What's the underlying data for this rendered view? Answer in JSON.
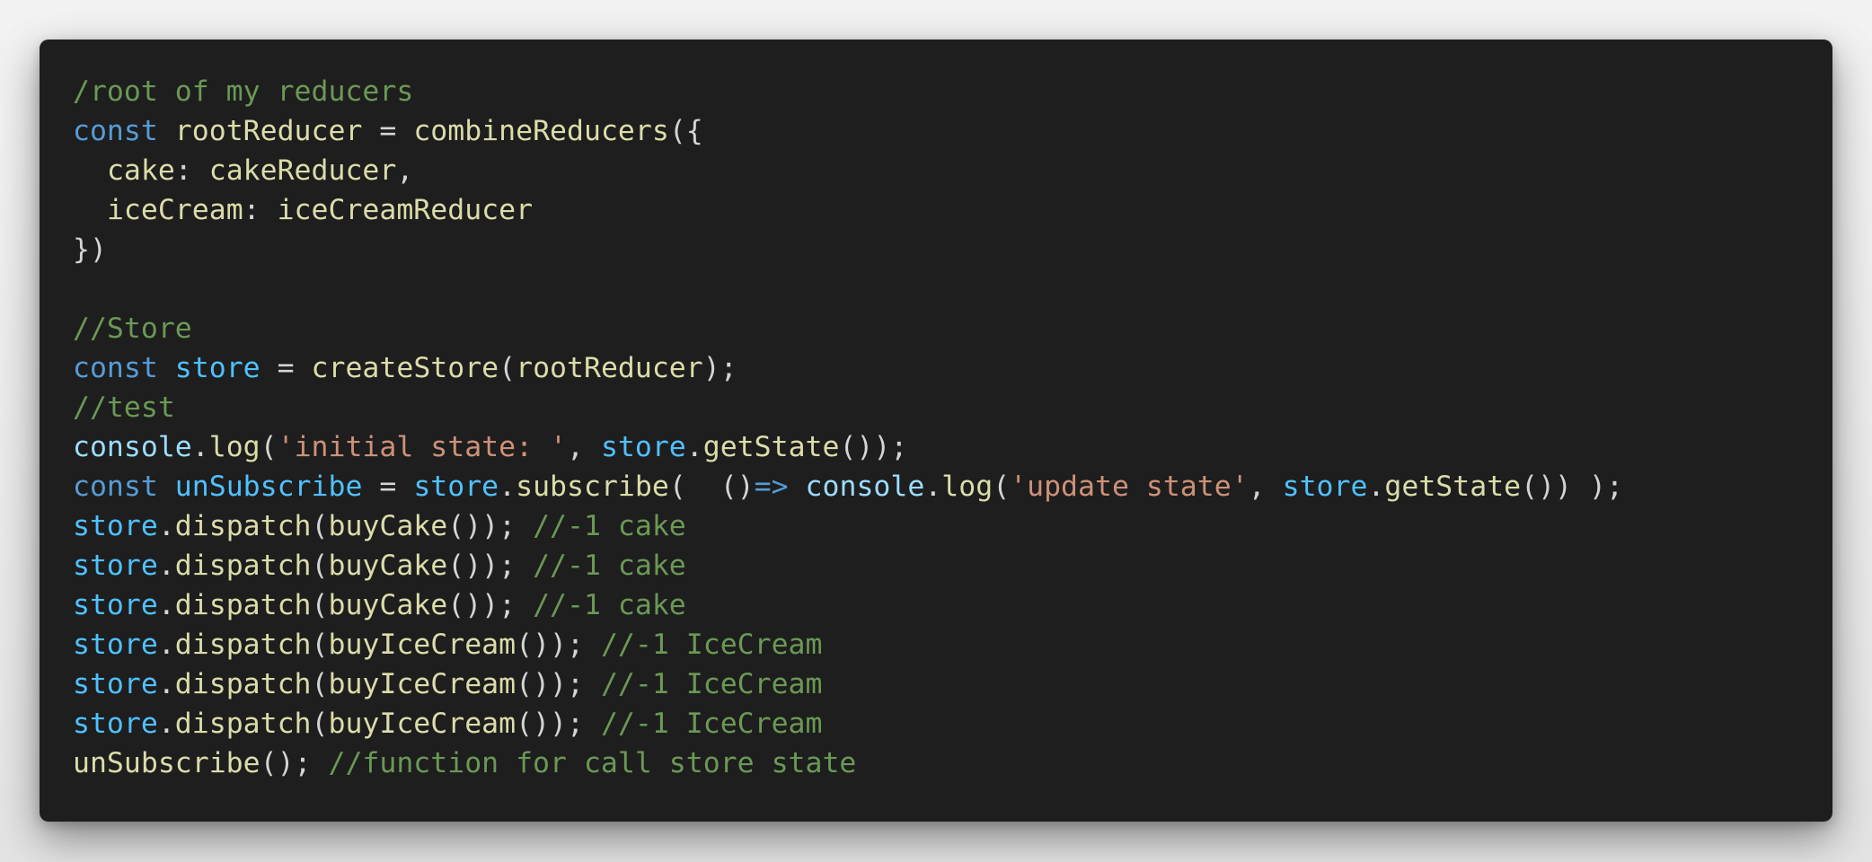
{
  "lines": [
    [
      {
        "t": "/root of my reducers",
        "c": "cmt"
      }
    ],
    [
      {
        "t": "const",
        "c": "kw"
      },
      {
        "t": " ",
        "c": "pun"
      },
      {
        "t": "rootReducer",
        "c": "ident"
      },
      {
        "t": " = ",
        "c": "pun"
      },
      {
        "t": "combineReducers",
        "c": "fn"
      },
      {
        "t": "({",
        "c": "pun"
      }
    ],
    [
      {
        "t": "  ",
        "c": "pun"
      },
      {
        "t": "cake",
        "c": "key"
      },
      {
        "t": ": ",
        "c": "pun"
      },
      {
        "t": "cakeReducer",
        "c": "ident"
      },
      {
        "t": ",",
        "c": "pun"
      }
    ],
    [
      {
        "t": "  ",
        "c": "pun"
      },
      {
        "t": "iceCream",
        "c": "key"
      },
      {
        "t": ": ",
        "c": "pun"
      },
      {
        "t": "iceCreamReducer",
        "c": "ident"
      }
    ],
    [
      {
        "t": "})",
        "c": "pun"
      }
    ],
    [],
    [
      {
        "t": "//Store",
        "c": "cmt"
      }
    ],
    [
      {
        "t": "const",
        "c": "kw"
      },
      {
        "t": " ",
        "c": "pun"
      },
      {
        "t": "store",
        "c": "var"
      },
      {
        "t": " = ",
        "c": "pun"
      },
      {
        "t": "createStore",
        "c": "fn"
      },
      {
        "t": "(",
        "c": "pun"
      },
      {
        "t": "rootReducer",
        "c": "ident"
      },
      {
        "t": ");",
        "c": "pun"
      }
    ],
    [
      {
        "t": "//test",
        "c": "cmt"
      }
    ],
    [
      {
        "t": "console",
        "c": "obj"
      },
      {
        "t": ".",
        "c": "pun"
      },
      {
        "t": "log",
        "c": "fn"
      },
      {
        "t": "(",
        "c": "pun"
      },
      {
        "t": "'initial state: '",
        "c": "str"
      },
      {
        "t": ", ",
        "c": "pun"
      },
      {
        "t": "store",
        "c": "var"
      },
      {
        "t": ".",
        "c": "pun"
      },
      {
        "t": "getState",
        "c": "fn"
      },
      {
        "t": "());",
        "c": "pun"
      }
    ],
    [
      {
        "t": "const",
        "c": "kw"
      },
      {
        "t": " ",
        "c": "pun"
      },
      {
        "t": "unSubscribe",
        "c": "var"
      },
      {
        "t": " = ",
        "c": "pun"
      },
      {
        "t": "store",
        "c": "var"
      },
      {
        "t": ".",
        "c": "pun"
      },
      {
        "t": "subscribe",
        "c": "fn"
      },
      {
        "t": "(  ()",
        "c": "pun"
      },
      {
        "t": "=>",
        "c": "kw"
      },
      {
        "t": " ",
        "c": "pun"
      },
      {
        "t": "console",
        "c": "obj"
      },
      {
        "t": ".",
        "c": "pun"
      },
      {
        "t": "log",
        "c": "fn"
      },
      {
        "t": "(",
        "c": "pun"
      },
      {
        "t": "'update state'",
        "c": "str"
      },
      {
        "t": ", ",
        "c": "pun"
      },
      {
        "t": "store",
        "c": "var"
      },
      {
        "t": ".",
        "c": "pun"
      },
      {
        "t": "getState",
        "c": "fn"
      },
      {
        "t": "()) );",
        "c": "pun"
      }
    ],
    [
      {
        "t": "store",
        "c": "var"
      },
      {
        "t": ".",
        "c": "pun"
      },
      {
        "t": "dispatch",
        "c": "fn"
      },
      {
        "t": "(",
        "c": "pun"
      },
      {
        "t": "buyCake",
        "c": "fn"
      },
      {
        "t": "()); ",
        "c": "pun"
      },
      {
        "t": "//-1 cake",
        "c": "cmt"
      }
    ],
    [
      {
        "t": "store",
        "c": "var"
      },
      {
        "t": ".",
        "c": "pun"
      },
      {
        "t": "dispatch",
        "c": "fn"
      },
      {
        "t": "(",
        "c": "pun"
      },
      {
        "t": "buyCake",
        "c": "fn"
      },
      {
        "t": "()); ",
        "c": "pun"
      },
      {
        "t": "//-1 cake",
        "c": "cmt"
      }
    ],
    [
      {
        "t": "store",
        "c": "var"
      },
      {
        "t": ".",
        "c": "pun"
      },
      {
        "t": "dispatch",
        "c": "fn"
      },
      {
        "t": "(",
        "c": "pun"
      },
      {
        "t": "buyCake",
        "c": "fn"
      },
      {
        "t": "()); ",
        "c": "pun"
      },
      {
        "t": "//-1 cake",
        "c": "cmt"
      }
    ],
    [
      {
        "t": "store",
        "c": "var"
      },
      {
        "t": ".",
        "c": "pun"
      },
      {
        "t": "dispatch",
        "c": "fn"
      },
      {
        "t": "(",
        "c": "pun"
      },
      {
        "t": "buyIceCream",
        "c": "fn"
      },
      {
        "t": "()); ",
        "c": "pun"
      },
      {
        "t": "//-1 IceCream",
        "c": "cmt"
      }
    ],
    [
      {
        "t": "store",
        "c": "var"
      },
      {
        "t": ".",
        "c": "pun"
      },
      {
        "t": "dispatch",
        "c": "fn"
      },
      {
        "t": "(",
        "c": "pun"
      },
      {
        "t": "buyIceCream",
        "c": "fn"
      },
      {
        "t": "()); ",
        "c": "pun"
      },
      {
        "t": "//-1 IceCream",
        "c": "cmt"
      }
    ],
    [
      {
        "t": "store",
        "c": "var"
      },
      {
        "t": ".",
        "c": "pun"
      },
      {
        "t": "dispatch",
        "c": "fn"
      },
      {
        "t": "(",
        "c": "pun"
      },
      {
        "t": "buyIceCream",
        "c": "fn"
      },
      {
        "t": "()); ",
        "c": "pun"
      },
      {
        "t": "//-1 IceCream",
        "c": "cmt"
      }
    ],
    [
      {
        "t": "unSubscribe",
        "c": "ident"
      },
      {
        "t": "(); ",
        "c": "pun"
      },
      {
        "t": "//function for call store state",
        "c": "cmt"
      }
    ]
  ]
}
